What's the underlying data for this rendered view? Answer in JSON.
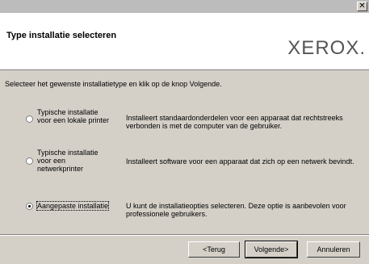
{
  "window": {
    "close_glyph": "✕"
  },
  "header": {
    "title": "Type installatie selecteren",
    "logo": "XEROX."
  },
  "instruction": "Selecteer het gewenste installatietype en klik op de knop Volgende.",
  "options": [
    {
      "label_lines": [
        "Typische installatie",
        "voor een lokale printer"
      ],
      "desc_lines": [
        "Installeert standaardonderdelen voor een apparaat dat rechtstreeks",
        "verbonden is met de computer van de gebruiker."
      ],
      "checked": false
    },
    {
      "label_lines": [
        "Typische installatie",
        "voor een",
        "netwerkprinter"
      ],
      "desc_lines": [
        "Installeert software voor een apparaat dat zich op een netwerk bevindt."
      ],
      "checked": false
    },
    {
      "label_lines": [
        "Aangepaste installatie"
      ],
      "desc_lines": [
        "U kunt de installatieopties selecteren. Deze optie is aanbevolen voor",
        "professionele gebruikers."
      ],
      "checked": true
    }
  ],
  "buttons": {
    "back": "<Terug",
    "next": "Volgende>",
    "cancel": "Annuleren"
  }
}
